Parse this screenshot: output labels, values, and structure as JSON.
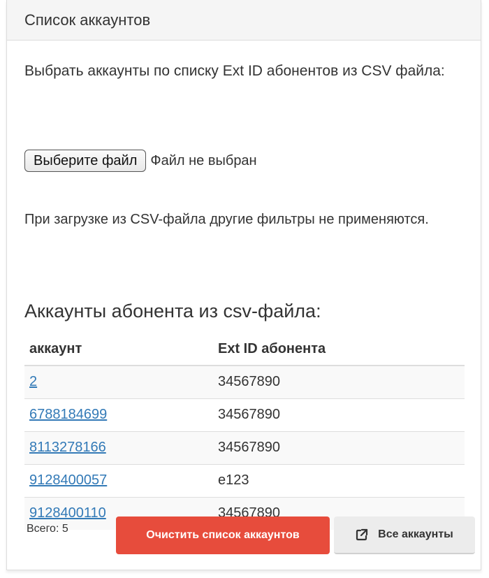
{
  "panel": {
    "title": "Список аккаунтов",
    "intro": "Выбрать аккаунты по списку Ext ID абонентов из CSV файла:",
    "file_button_label": "Выберите файл",
    "file_status": "Файл не выбран",
    "note": "При загрузке из CSV-файла другие фильтры не применяются."
  },
  "accounts_section": {
    "title": "Аккаунты абонента из csv-файла:",
    "columns": [
      "аккаунт",
      "Ext ID абонента"
    ],
    "rows": [
      {
        "account": "2",
        "ext_id": "34567890"
      },
      {
        "account": "6788184699",
        "ext_id": "34567890"
      },
      {
        "account": "8113278166",
        "ext_id": "34567890"
      },
      {
        "account": "9128400057",
        "ext_id": "e123"
      },
      {
        "account": "9128400110",
        "ext_id": "34567890"
      }
    ]
  },
  "footer": {
    "total": "Всего: 5",
    "clear_button": "Очистить список аккаунтов",
    "all_button": "Все аккаунты",
    "all_button_icon": "external-link-icon"
  },
  "colors": {
    "link": "#337ab7",
    "danger": "#e74c3c",
    "heading_bg": "#f5f5f5"
  }
}
